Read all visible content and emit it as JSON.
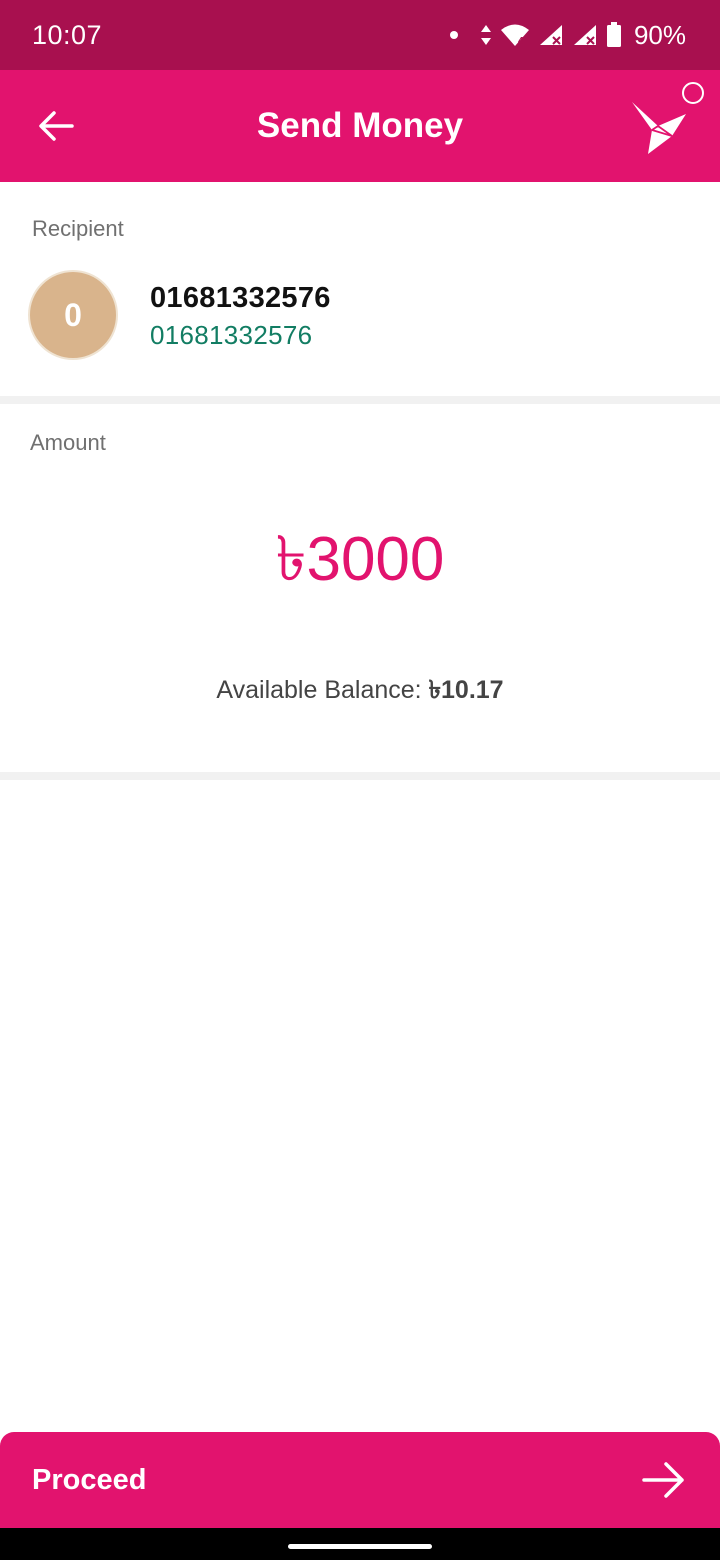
{
  "status_bar": {
    "time": "10:07",
    "battery": "90%",
    "icons": [
      "notification-dot-icon",
      "data-arrows-icon",
      "wifi-icon",
      "signal-icon",
      "signal-x-icon",
      "battery-icon"
    ]
  },
  "app_bar": {
    "title": "Send Money",
    "back_icon": "arrow-left-icon",
    "logo_icon": "bird-logo-icon"
  },
  "recipient": {
    "label": "Recipient",
    "avatar_initial": "0",
    "name": "01681332576",
    "number": "01681332576"
  },
  "amount": {
    "label": "Amount",
    "value": "৳3000",
    "balance_label": "Available Balance: ",
    "balance_value": "৳10.17"
  },
  "proceed": {
    "label": "Proceed",
    "icon": "arrow-right-icon"
  },
  "colors": {
    "brand": "#e2136e",
    "status_bar": "#a8104f",
    "recipient_number": "#127d63",
    "avatar": "#d9b48c"
  }
}
